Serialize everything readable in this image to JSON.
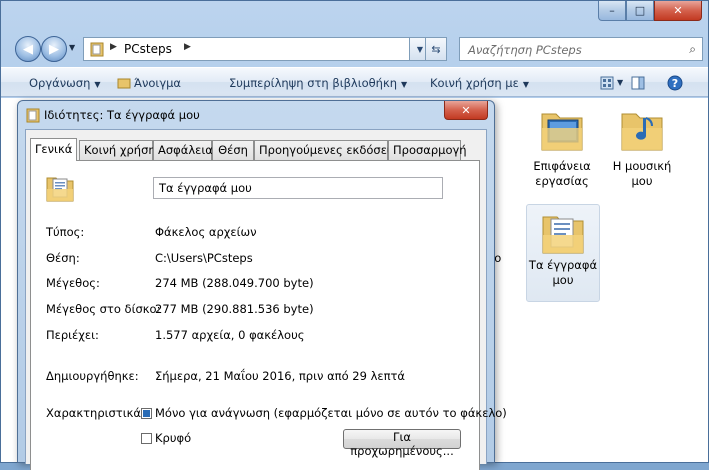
{
  "explorer": {
    "caption": {
      "minimize": "–",
      "maximize": "□",
      "close": "✕"
    },
    "address": {
      "path_segment": "PCsteps"
    },
    "search": {
      "placeholder": "Αναζήτηση PCsteps"
    },
    "commands": {
      "organize": "Οργάνωση",
      "open": "Άνοιγμα",
      "include_library": "Συμπερίληψη στη βιβλιοθήκη",
      "share_with": "Κοινή χρήση με"
    },
    "items": [
      {
        "label": "Επιφάνεια εργασίας",
        "icon": "desktop-folder-icon"
      },
      {
        "label": "Η μουσική μου",
        "icon": "music-folder-icon"
      },
      {
        "label": "Τα έγγραφά μου",
        "icon": "documents-folder-icon",
        "selected": true
      }
    ],
    "edge_fragment": "εο"
  },
  "dialog": {
    "title": "Ιδιότητες: Τα έγγραφά μου",
    "close": "✕",
    "tabs": [
      {
        "label": "Γενικά",
        "active": true
      },
      {
        "label": "Κοινή χρήση"
      },
      {
        "label": "Ασφάλεια"
      },
      {
        "label": "Θέση"
      },
      {
        "label": "Προηγούμενες εκδόσεις"
      },
      {
        "label": "Προσαρμογή"
      }
    ],
    "general": {
      "name": "Τα έγγραφά μου",
      "type_label": "Τύπος:",
      "type_value": "Φάκελος αρχείων",
      "location_label": "Θέση:",
      "location_value": "C:\\Users\\PCsteps",
      "size_label": "Μέγεθος:",
      "size_value": "274 MB (288.049.700 byte)",
      "disk_size_label": "Μέγεθος στο δίσκο:",
      "disk_size_value": "277 MB (290.881.536 byte)",
      "contains_label": "Περιέχει:",
      "contains_value": "1.577 αρχεία, 0 φακέλους",
      "created_label": "Δημιουργήθηκε:",
      "created_value": "Σήμερα, 21 Μαΐου 2016, πριν από 29 λεπτά",
      "attributes_label": "Χαρακτηριστικά:",
      "readonly_label": "Μόνο για ανάγνωση (εφαρμόζεται μόνο σε αυτόν το φάκελο)",
      "hidden_label": "Κρυφό",
      "advanced_button": "Για προχωρημένους..."
    }
  },
  "colors": {
    "accent": "#2b6cb5",
    "title_close": "#c23a22",
    "command_text": "#1e395b"
  }
}
